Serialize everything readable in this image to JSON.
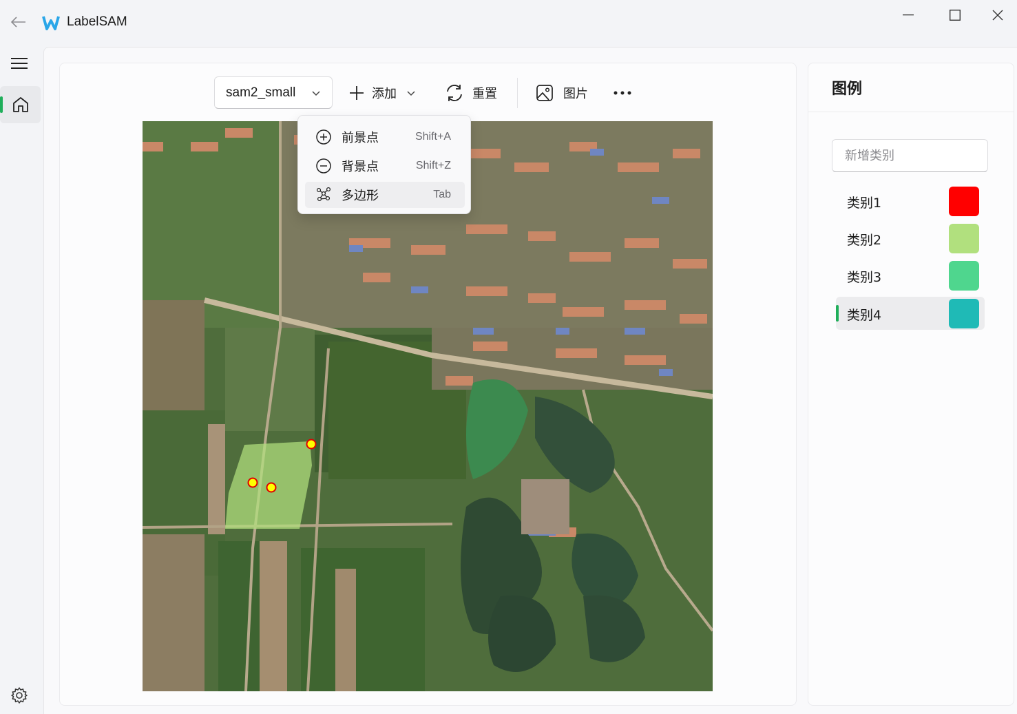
{
  "app": {
    "title": "LabelSAM"
  },
  "toolbar": {
    "model": "sam2_small",
    "add_label": "添加",
    "reset_label": "重置",
    "image_label": "图片"
  },
  "add_menu": {
    "items": [
      {
        "label": "前景点",
        "shortcut": "Shift+A",
        "icon": "plus-circle-icon"
      },
      {
        "label": "背景点",
        "shortcut": "Shift+Z",
        "icon": "minus-circle-icon"
      },
      {
        "label": "多边形",
        "shortcut": "Tab",
        "icon": "polygon-icon",
        "selected": true
      }
    ]
  },
  "legend": {
    "title": "图例",
    "new_category_placeholder": "新增类别",
    "categories": [
      {
        "label": "类别1",
        "color": "#ff0000"
      },
      {
        "label": "类别2",
        "color": "#b1e07e"
      },
      {
        "label": "类别3",
        "color": "#4fd68e"
      },
      {
        "label": "类别4",
        "color": "#1fbab6",
        "selected": true
      }
    ]
  },
  "canvas": {
    "mask_color": "#b1e07e",
    "point_color": "#ffff00",
    "point_outline": "#e00000",
    "point_count": 3
  }
}
